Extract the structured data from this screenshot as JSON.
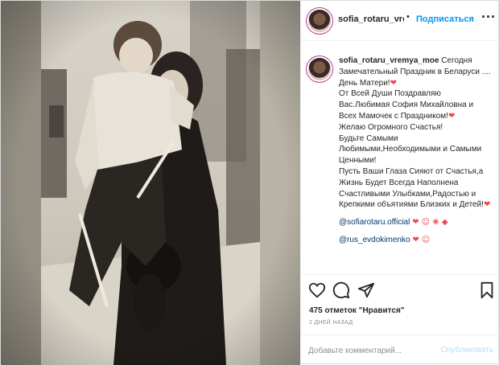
{
  "post": {
    "username_header": "sofia_rotaru_vremy",
    "follow_label": "Подписаться",
    "more_icon": "more-options-icon"
  },
  "caption": {
    "username": "sofia_rotaru_vremya_moe",
    "line1": "Сегодня Замечательный Праздник в Беларуси .... День Матери!",
    "line2": "От Всей Души Поздравляю Вас.Любимая София Михайловна и Всех Мамочек с Праздником!",
    "line3": "Желаю Огромного Счастья!",
    "line4": "Будьте Самыми Любимыми,Необходимыми и Самыми Ценными!",
    "line5": "Пусть Ваши Глаза Сияют от Счастья,а Жизнь Будет Всегда Наполнена Счастливыми Улыбками,Радостью и Крепкими объятиями Близких и Детей!",
    "heart": "❤",
    "mention1": "@sofiarotaru.official",
    "mention1_emojis": "❤ ☺ ❀ ◆",
    "mention2": "@rus_evdokimenko",
    "mention2_emojis": "❤ ☺"
  },
  "actions": {
    "icons": [
      "heart-icon",
      "comment-icon",
      "share-icon",
      "bookmark-icon"
    ],
    "likes": "475 отметок \"Нравится\"",
    "date": "2 ДНЕЙ НАЗАД"
  },
  "comment": {
    "placeholder": "Добавьте комментарий...",
    "publish_label": "Опубликовать"
  },
  "colors": {
    "accent": "#0095f6",
    "link": "#00376b",
    "heart": "#ed4956",
    "muted": "#8e8e8e",
    "publish_disabled": "#b2dffc"
  }
}
